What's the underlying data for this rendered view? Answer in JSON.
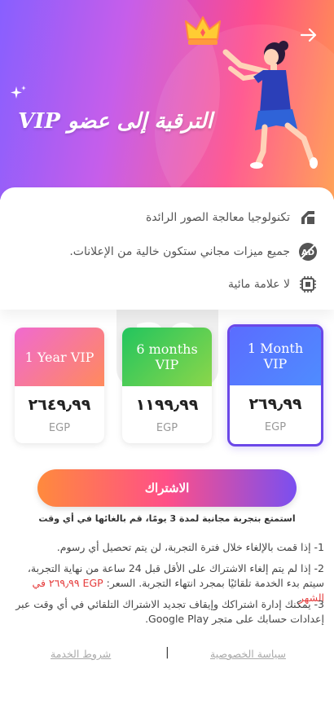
{
  "hero": {
    "title": "الترقية إلى عضو VIP",
    "colors": {
      "gradient_start": "#7b4dff",
      "gradient_mid": "#ff4f8a",
      "gradient_end": "#ff9a4a"
    }
  },
  "features": [
    {
      "icon": "tech-icon",
      "text": "تكنولوجيا معالجة الصور الرائدة"
    },
    {
      "icon": "no-ads-icon",
      "text": "جميع ميزات مجاني ستكون خالية من الإعلانات."
    },
    {
      "icon": "no-watermark-icon",
      "text": "لا علامة مائية"
    }
  ],
  "plans": [
    {
      "id": "year",
      "title_line1": "1 Year VIP",
      "title_line2": "",
      "price": "٢٦٤٩٫٩٩",
      "currency": "EGP",
      "gradient": [
        "#f06ad0",
        "#ff8a5c"
      ],
      "selected": false
    },
    {
      "id": "six",
      "title_line1": "6 months",
      "title_line2": "VIP",
      "price": "١١٩٩٫٩٩",
      "currency": "EGP",
      "gradient": [
        "#22c55e",
        "#8bd64a"
      ],
      "selected": false
    },
    {
      "id": "month",
      "title_line1": "1 Month",
      "title_line2": "VIP",
      "price": "٢٦٩٫٩٩",
      "currency": "EGP",
      "gradient": [
        "#5b6cff",
        "#4f8cff"
      ],
      "selected": true
    }
  ],
  "subscribe": {
    "label": "الاشتراك",
    "trial_note": "استمتع بتجربة مجانية لمدة 3 يومًا، قم بالغائها في أي وقت"
  },
  "terms": {
    "line1": "1- إذا قمت بالإلغاء خلال فترة التجربة، لن يتم تحصيل أي رسوم.",
    "line2_prefix": "2- إذا لم يتم إلغاء الاشتراك على الأقل قبل 24 ساعة من نهاية التجربة، سيتم بدء الخدمة تلقائيًا بمجرد انتهاء التجربة. السعر: ",
    "line2_price": "EGP ٢٦٩٫٩٩ في الشهر",
    "line3": "3- يمكنك إدارة اشتراكك وإيقاف تجديد الاشتراك التلقائي في أي وقت عبر إعدادات حسابك على متجر Google Play."
  },
  "footer": {
    "privacy": "سياسة الخصوصية",
    "separator": "|",
    "terms": "شروط الخدمة"
  },
  "colors": {
    "accent_purple": "#6b47e8",
    "price_red": "#e53a3a"
  }
}
